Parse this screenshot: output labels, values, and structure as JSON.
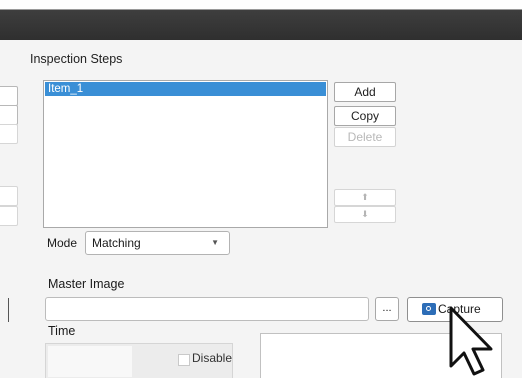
{
  "section": {
    "title": "Inspection Steps"
  },
  "steps": {
    "items": [
      "Item_1"
    ]
  },
  "buttons": {
    "add": "Add",
    "copy": "Copy",
    "delete": "Delete",
    "move_up": "⬆",
    "move_down": "⬇"
  },
  "mode": {
    "label": "Mode",
    "value": "Matching",
    "caret": "▼"
  },
  "master_image": {
    "label": "Master Image",
    "value": "",
    "browse_label": "...",
    "capture_label": "Capture",
    "capture_icon": "camera-icon"
  },
  "time": {
    "label": "Time",
    "disable_label": "Disable"
  },
  "colors": {
    "selection": "#3a8fd6",
    "titlebar": "#333333",
    "capture_icon": "#2d6db7"
  }
}
